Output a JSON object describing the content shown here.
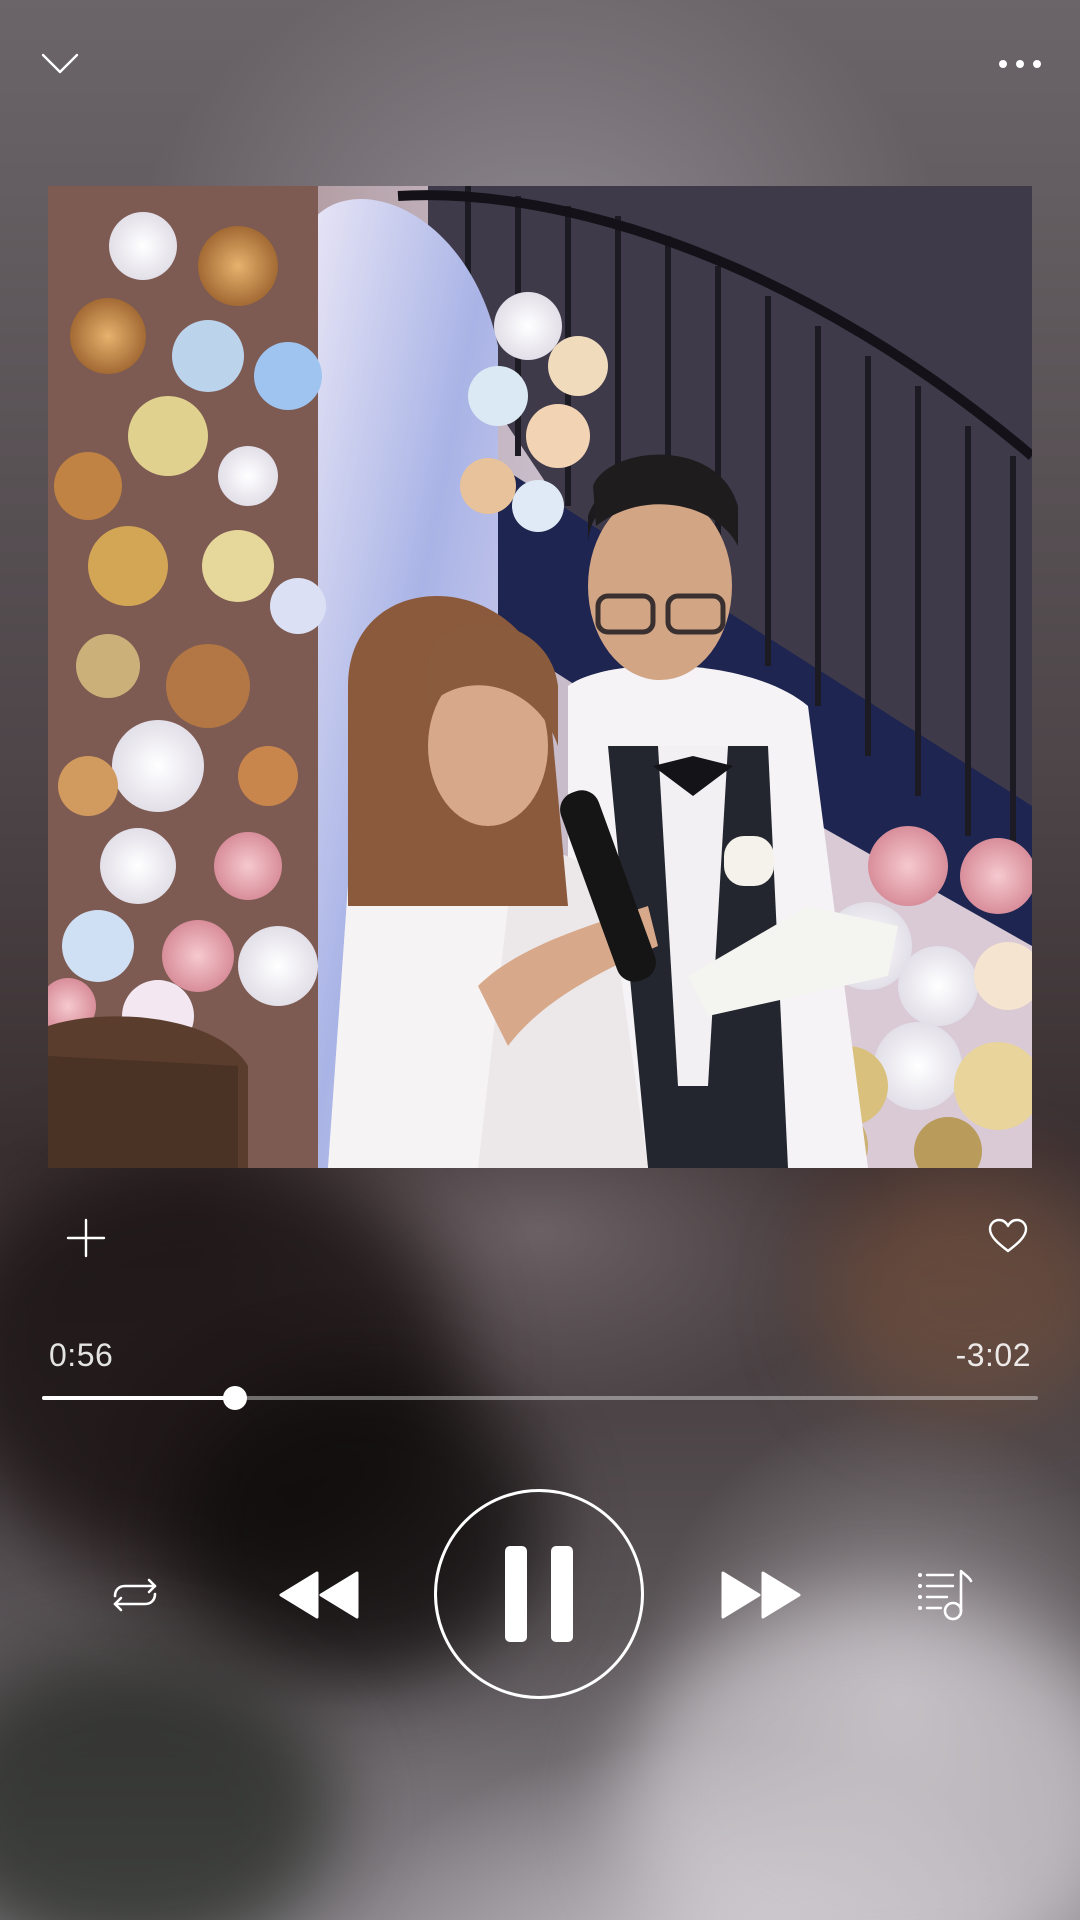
{
  "header": {
    "collapse_icon": "chevron-down-icon",
    "more_icon": "more-icon"
  },
  "artwork": {
    "description_icon": "album-artwork"
  },
  "actions": {
    "add_icon": "plus-icon",
    "like_icon": "heart-icon"
  },
  "playback": {
    "elapsed": "0:56",
    "remaining": "-3:02",
    "progress_fraction": 0.1935
  },
  "controls": {
    "repeat_icon": "repeat-icon",
    "previous_icon": "rewind-icon",
    "play_state": "playing",
    "pause_icon": "pause-icon",
    "next_icon": "fast-forward-icon",
    "queue_icon": "playlist-icon"
  },
  "colors": {
    "foreground": "#ffffff",
    "track_inactive": "rgba(255,255,255,0.38)"
  }
}
